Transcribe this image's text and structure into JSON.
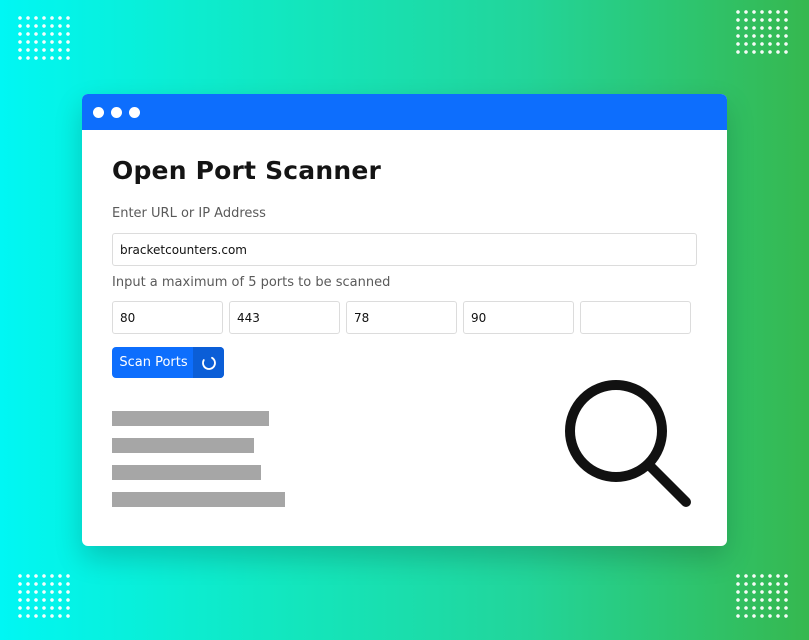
{
  "window": {
    "title": "Open Port Scanner",
    "accent_color": "#0d6efd"
  },
  "form": {
    "url_label": "Enter URL or IP Address",
    "url_value": "bracketcounters.com",
    "ports_label": "Input a maximum of 5 ports to be scanned",
    "ports": [
      "80",
      "443",
      "78",
      "90",
      ""
    ],
    "scan_button": "Scan Ports"
  },
  "icons": {
    "spinner": "loading-spinner-icon",
    "search": "magnifier-icon"
  }
}
